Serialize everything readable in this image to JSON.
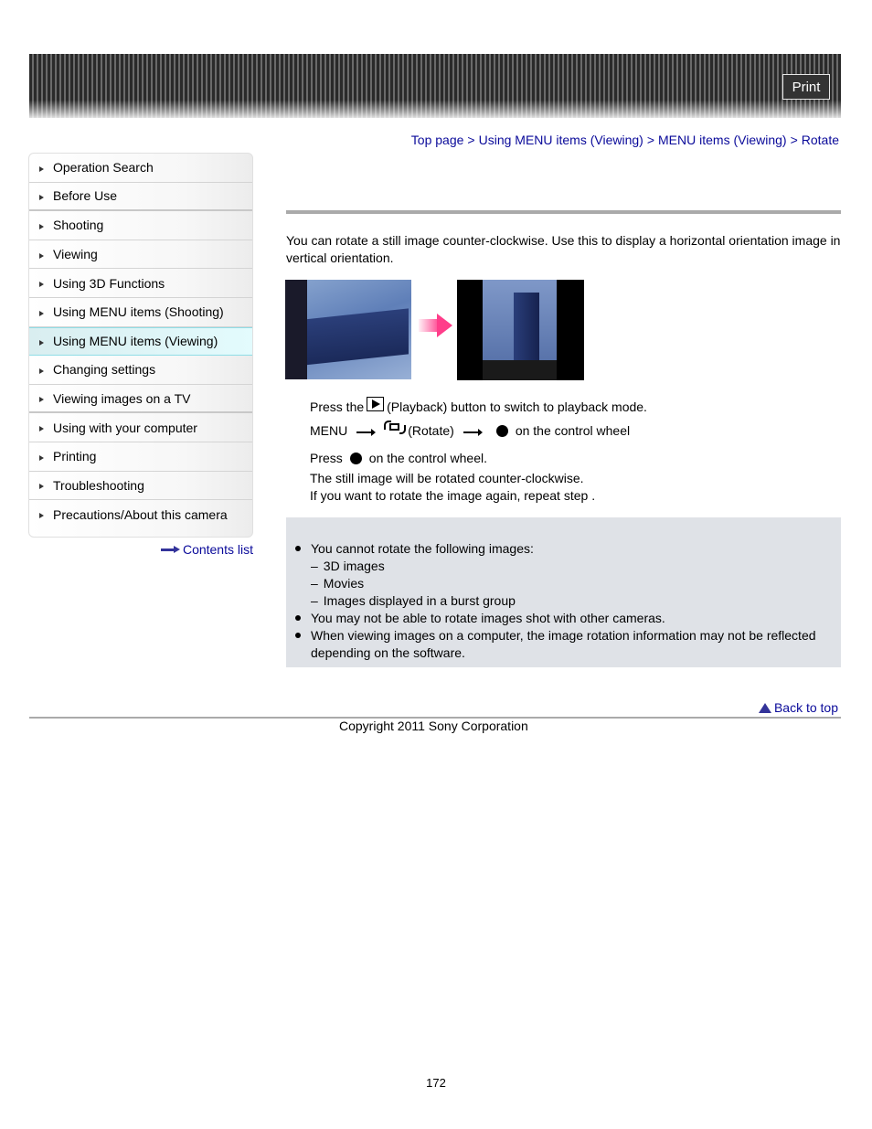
{
  "header": {
    "print_label": "Print"
  },
  "breadcrumb": {
    "items": [
      "Top page",
      "Using MENU items (Viewing)",
      "MENU items (Viewing)",
      "Rotate"
    ],
    "separator": ">"
  },
  "sidebar": {
    "items": [
      {
        "label": "Operation Search"
      },
      {
        "label": "Before Use"
      },
      {
        "label": "Shooting"
      },
      {
        "label": "Viewing"
      },
      {
        "label": "Using 3D Functions"
      },
      {
        "label": "Using MENU items (Shooting)"
      },
      {
        "label": "Using MENU items (Viewing)",
        "active": true
      },
      {
        "label": "Changing settings"
      },
      {
        "label": "Viewing images on a TV"
      },
      {
        "label": "Using with your computer"
      },
      {
        "label": "Printing"
      },
      {
        "label": "Troubleshooting"
      },
      {
        "label": "Precautions/About this camera"
      }
    ],
    "contents_list_label": "Contents list"
  },
  "main": {
    "intro": "You can rotate a still image counter-clockwise. Use this to display a horizontal orientation image in vertical orientation.",
    "steps": {
      "step1_prefix": "Press the",
      "step1_suffix": "(Playback) button to switch to playback mode.",
      "step2_menu": "MENU",
      "step2_rotate": "(Rotate)",
      "step2_suffix": "on the control wheel",
      "step3_prefix": "Press",
      "step3_suffix": "on the control wheel.",
      "step3_note1": "The still image will be rotated counter-clockwise.",
      "step3_note2": "If you want to rotate the image again, repeat step    ."
    },
    "notes": {
      "bullet1": "You cannot rotate the following images:",
      "sub": [
        "3D images",
        "Movies",
        "Images displayed in a burst group"
      ],
      "dash": "–",
      "bullet2": "You may not be able to rotate images shot with other cameras.",
      "bullet3": "When viewing images on a computer, the image rotation information may not be reflected depending on the software."
    }
  },
  "footer": {
    "back_to_top": "Back to top",
    "copyright": "Copyright 2011 Sony Corporation",
    "page_number": "172"
  },
  "colors": {
    "link": "#0a0a9a",
    "active_nav_bg": "#e0f7fa",
    "active_nav_border": "#8fdde6",
    "note_bg": "#dfe2e7",
    "arrow_pink": "#ff3d8a"
  }
}
